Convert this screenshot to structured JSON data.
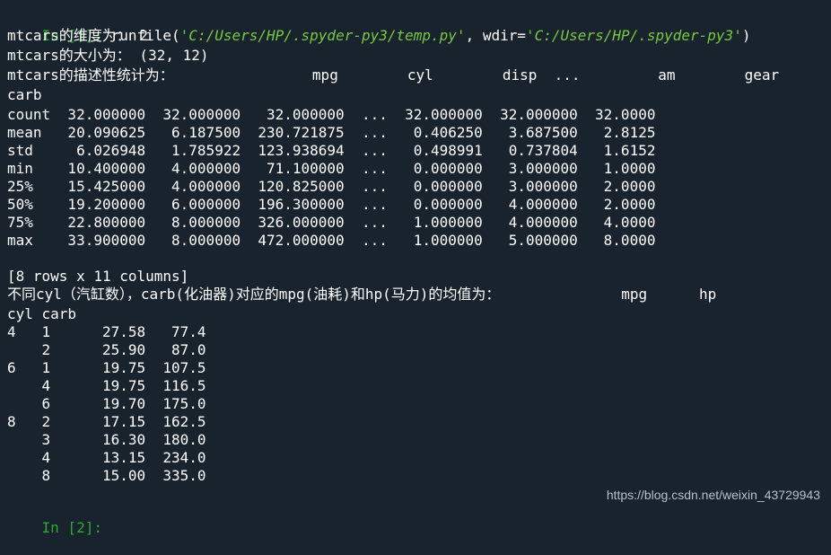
{
  "console": {
    "run_prompt": "In [1]:",
    "run_call_pre": " runfile(",
    "run_arg1": "'C:/Users/HP/.spyder-py3/temp.py'",
    "run_sep": ", wdir=",
    "run_arg2": "'C:/Users/HP/.spyder-py3'",
    "run_close": ")",
    "dims_line": "mtcars的维度为： 2",
    "size_line": "mtcars的大小为： (32, 12)",
    "describe_header": "mtcars的描述性统计为：                mpg        cyl        disp  ...         am        gear",
    "carb_label": "carb",
    "describe_rows": [
      "count  32.000000  32.000000   32.000000  ...  32.000000  32.000000  32.0000",
      "mean   20.090625   6.187500  230.721875  ...   0.406250   3.687500   2.8125",
      "std     6.026948   1.785922  123.938694  ...   0.498991   0.737804   1.6152",
      "min    10.400000   4.000000   71.100000  ...   0.000000   3.000000   1.0000",
      "25%    15.425000   4.000000  120.825000  ...   0.000000   3.000000   2.0000",
      "50%    19.200000   6.000000  196.300000  ...   0.000000   4.000000   2.0000",
      "75%    22.800000   8.000000  326.000000  ...   1.000000   4.000000   4.0000",
      "max    33.900000   8.000000  472.000000  ...   1.000000   5.000000   8.0000"
    ],
    "rows_cols_note": "[8 rows x 11 columns]",
    "group_title": "不同cyl（汽缸数），carb(化油器)对应的mpg(油耗)和hp(马力)的均值为：              mpg      hp",
    "group_index_header": "cyl carb",
    "group_rows": [
      "4   1      27.58   77.4",
      "    2      25.90   87.0",
      "6   1      19.75  107.5",
      "    4      19.75  116.5",
      "    6      19.70  175.0",
      "8   2      17.15  162.5",
      "    3      16.30  180.0",
      "    4      13.15  234.0",
      "    8      15.00  335.0"
    ],
    "next_prompt": "In [2]:"
  },
  "watermark": "https://blog.csdn.net/weixin_43729943",
  "colors": {
    "background": "#19232d",
    "prompt": "#2fa82f",
    "string": "#78c840",
    "text": "#ffffff"
  }
}
